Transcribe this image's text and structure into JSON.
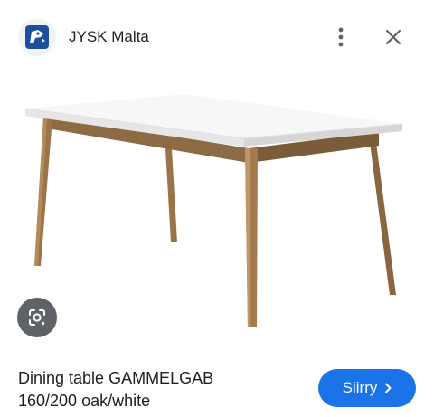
{
  "header": {
    "site_name": "JYSK Malta",
    "logo_icon": "jysk-bird-logo",
    "menu_icon": "more-vert-icon",
    "close_icon": "close-icon"
  },
  "image": {
    "subject": "dining table",
    "lens_icon": "google-lens-icon"
  },
  "product": {
    "title_line1": "Dining table GAMMELGAB",
    "title_line2": "160/200 oak/white"
  },
  "visit_button": {
    "label": "Siirry",
    "icon": "chevron-right-icon"
  },
  "colors": {
    "accent": "#1a73e8",
    "logo_blue": "#1d4f9c",
    "lens_bg": "#5f6368"
  }
}
